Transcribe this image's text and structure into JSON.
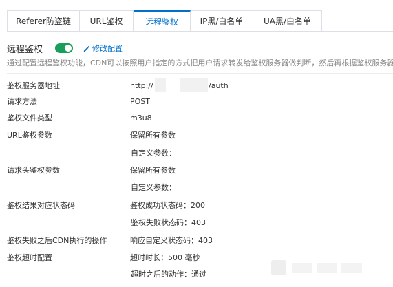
{
  "tabs": [
    {
      "label": "Referer防盗链",
      "active": false
    },
    {
      "label": "URL鉴权",
      "active": false
    },
    {
      "label": "远程鉴权",
      "active": true
    },
    {
      "label": "IP黑/白名单",
      "active": false
    },
    {
      "label": "UA黑/白名单",
      "active": false
    }
  ],
  "section": {
    "title": "远程鉴权",
    "toggle_on": true,
    "edit_label": "修改配置",
    "description": "通过配置远程鉴权功能，CDN可以按照用户指定的方式把用户请求转发给鉴权服务器做判断，然后再根据鉴权服务器"
  },
  "config": {
    "server_address": {
      "label": "鉴权服务器地址",
      "value_prefix": "http://",
      "value_suffix": "/auth"
    },
    "method": {
      "label": "请求方法",
      "value": "POST"
    },
    "file_type": {
      "label": "鉴权文件类型",
      "value": "m3u8"
    },
    "url_params": {
      "label": "URL鉴权参数",
      "value": "保留所有参数",
      "sub": "自定义参数："
    },
    "header_params": {
      "label": "请求头鉴权参数",
      "value": "保留所有参数",
      "sub": "自定义参数："
    },
    "result_status": {
      "label": "鉴权结果对应状态码",
      "value": "鉴权成功状态码：200",
      "sub": "鉴权失败状态码：403"
    },
    "fail_action": {
      "label": "鉴权失败之后CDN执行的操作",
      "value": "响应自定义状态码：403"
    },
    "timeout": {
      "label": "鉴权超时配置",
      "value": "超时时长：500 毫秒",
      "sub": "超时之后的动作：通过"
    }
  },
  "colors": {
    "accent": "#0070cc",
    "toggle_on": "#1a9e5b",
    "text": "#333333",
    "muted": "#888888"
  }
}
